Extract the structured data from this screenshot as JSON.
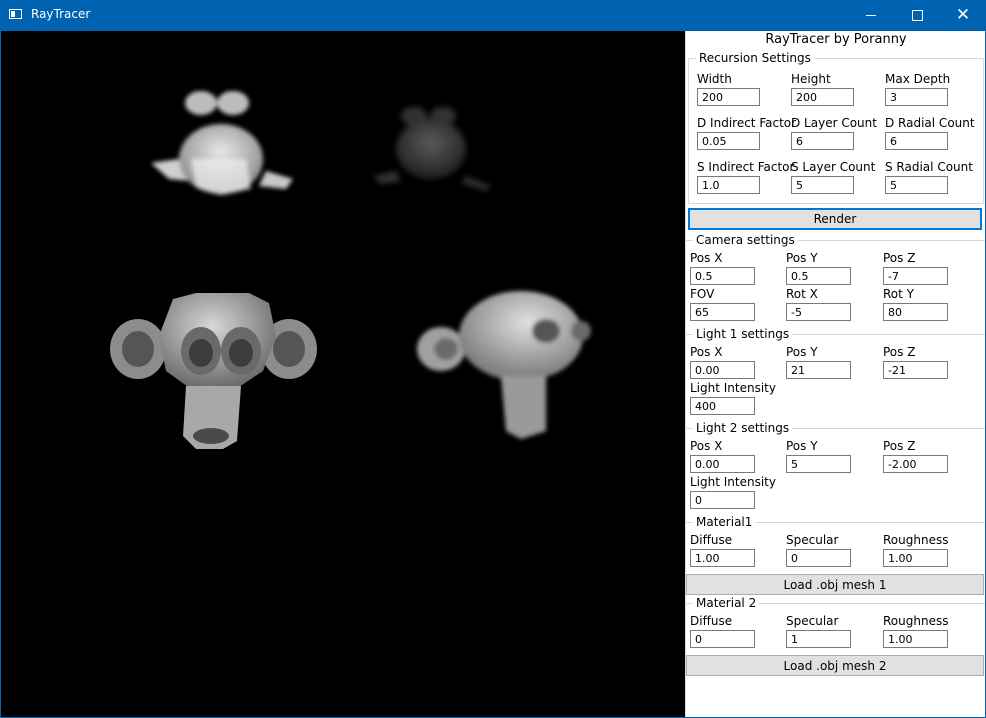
{
  "window": {
    "title": "RayTracer"
  },
  "panel": {
    "title": "RayTracer by Poranny",
    "recursion": {
      "label": "Recursion Settings",
      "width_label": "Width",
      "width": "200",
      "height_label": "Height",
      "height": "200",
      "max_depth_label": "Max Depth",
      "max_depth": "3",
      "d_indirect_label": "D Indirect Factor",
      "d_indirect": "0.05",
      "d_layer_label": "D Layer Count",
      "d_layer": "6",
      "d_radial_label": "D Radial Count",
      "d_radial": "6",
      "s_indirect_label": "S Indirect Factor",
      "s_indirect": "1.0",
      "s_layer_label": "S Layer Count",
      "s_layer": "5",
      "s_radial_label": "S Radial Count",
      "s_radial": "5"
    },
    "render_label": "Render",
    "camera": {
      "label": "Camera settings",
      "posx_label": "Pos X",
      "posx": "0.5",
      "posy_label": "Pos Y",
      "posy": "0.5",
      "posz_label": "Pos Z",
      "posz": "-7",
      "fov_label": "FOV",
      "fov": "65",
      "rotx_label": "Rot X",
      "rotx": "-5",
      "roty_label": "Rot Y",
      "roty": "80"
    },
    "light1": {
      "label": "Light 1 settings",
      "posx_label": "Pos X",
      "posx": "0.00",
      "posy_label": "Pos Y",
      "posy": "21",
      "posz_label": "Pos Z",
      "posz": "-21",
      "intensity_label": "Light Intensity",
      "intensity": "400"
    },
    "light2": {
      "label": "Light 2 settings",
      "posx_label": "Pos X",
      "posx": "0.00",
      "posy_label": "Pos Y",
      "posy": "5",
      "posz_label": "Pos Z",
      "posz": "-2.00",
      "intensity_label": "Light Intensity",
      "intensity": "0"
    },
    "material1": {
      "label": "Material1",
      "diffuse_label": "Diffuse",
      "diffuse": "1.00",
      "specular_label": "Specular",
      "specular": "0",
      "roughness_label": "Roughness",
      "roughness": "1.00",
      "load_label": "Load .obj mesh 1"
    },
    "material2": {
      "label": "Material 2",
      "diffuse_label": "Diffuse",
      "diffuse": "0",
      "specular_label": "Specular",
      "specular": "1",
      "roughness_label": "Roughness",
      "roughness": "1.00",
      "load_label": "Load .obj mesh 2"
    }
  },
  "colors": {
    "titlebar": "#0063b1",
    "viewport_bg": "#000000",
    "focus": "#0078d7"
  },
  "icons": [
    "app-icon",
    "minimize-icon",
    "maximize-icon",
    "close-icon"
  ]
}
